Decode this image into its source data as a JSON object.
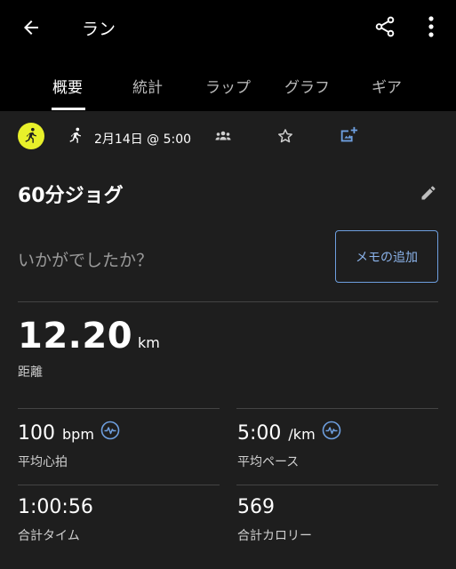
{
  "header": {
    "title": "ラン"
  },
  "tabs": [
    {
      "label": "概要",
      "active": true
    },
    {
      "label": "統計",
      "active": false
    },
    {
      "label": "ラップ",
      "active": false
    },
    {
      "label": "グラフ",
      "active": false
    },
    {
      "label": "ギア",
      "active": false
    }
  ],
  "activity": {
    "date": "2月14日 @ 5:00",
    "name": "60分ジョグ",
    "prompt": "いかがでしたか？",
    "memo_button": "メモの追加"
  },
  "distance": {
    "value": "12.20",
    "unit": "km",
    "label": "距離"
  },
  "stats": [
    {
      "value": "100",
      "unit": "bpm",
      "label": "平均心拍",
      "icon": "heart-rate-icon"
    },
    {
      "value": "5:00",
      "unit": "/km",
      "label": "平均ペース",
      "icon": "heart-rate-icon"
    },
    {
      "value": "1:00:56",
      "unit": "",
      "label": "合計タイム"
    },
    {
      "value": "569",
      "unit": "",
      "label": "合計カロリー"
    }
  ],
  "colors": {
    "background": "#000000",
    "panel": "#1e1e1e",
    "accent_blue": "#6e9fdf",
    "activity_badge": "#e8f02a"
  }
}
